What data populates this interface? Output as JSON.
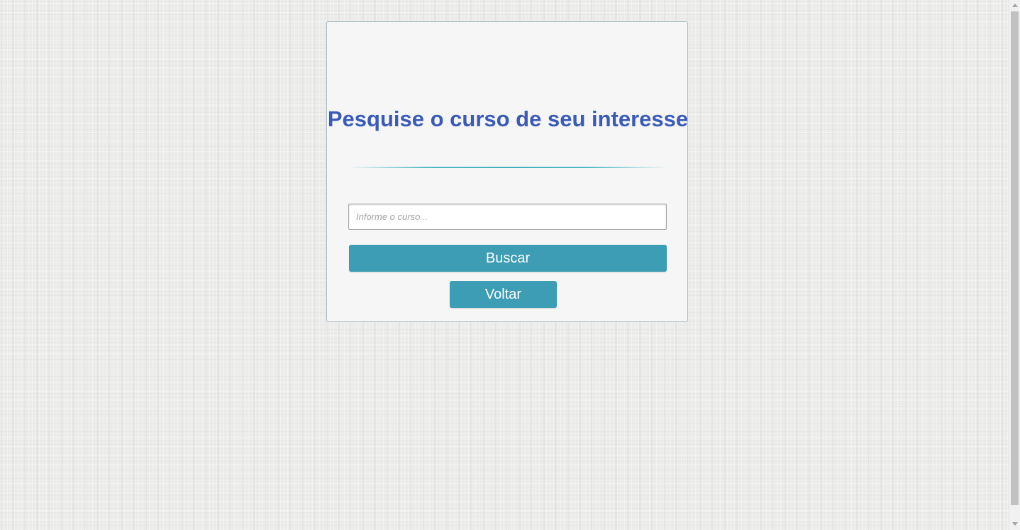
{
  "search_page": {
    "title": "Pesquise o curso de seu interesse",
    "input": {
      "placeholder": "Informe o curso...",
      "value": ""
    },
    "search_button_label": "Buscar",
    "back_button_label": "Voltar"
  },
  "colors": {
    "title": "#3a5bb8",
    "button": "#3c9db4",
    "divider": "#4cbac4",
    "card_background": "#f6f6f6",
    "page_background": "#ececeb"
  }
}
